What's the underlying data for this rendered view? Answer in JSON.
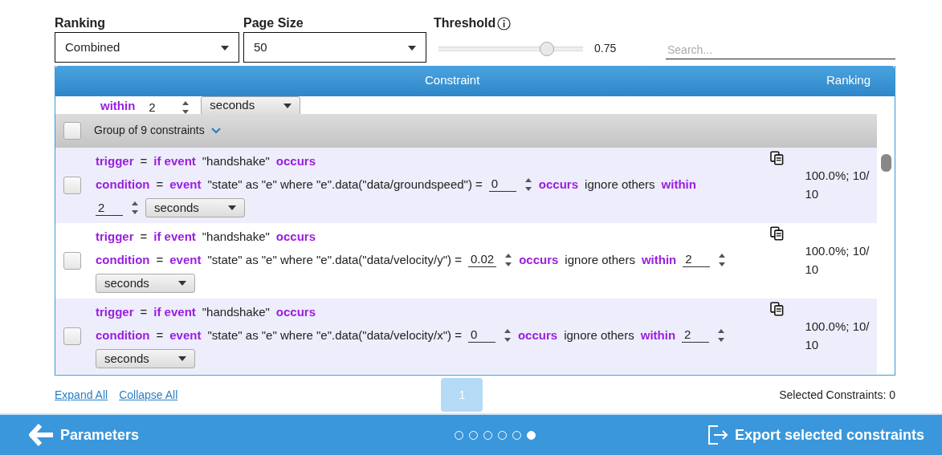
{
  "filters": {
    "ranking": {
      "label": "Ranking",
      "value": "Combined"
    },
    "page_size": {
      "label": "Page Size",
      "value": "50"
    },
    "threshold": {
      "label": "Threshold",
      "level": 0.75,
      "reading": "0.75"
    },
    "search": {
      "placeholder": "Search..."
    }
  },
  "table": {
    "columns": [
      "Constraint",
      "Ranking"
    ],
    "partial_row": [
      {
        "kind": "kw",
        "text": "within"
      },
      {
        "kind": "num",
        "value": "2"
      },
      {
        "kind": "select",
        "value": "seconds"
      }
    ],
    "group": {
      "label": "Group of 9 constraints",
      "checked": false,
      "expanded": true
    },
    "rows": [
      {
        "checked": false,
        "shaded": true,
        "ranking": "100.0%; 10/10",
        "lines": [
          [
            {
              "kind": "kw",
              "text": "trigger"
            },
            {
              "kind": "text",
              "text": "="
            },
            {
              "kind": "kw",
              "text": "if event"
            },
            {
              "kind": "text",
              "text": "\"handshake\""
            },
            {
              "kind": "kw",
              "text": "occurs"
            }
          ],
          [
            {
              "kind": "kw",
              "text": "condition"
            },
            {
              "kind": "text",
              "text": "="
            },
            {
              "kind": "kw",
              "text": "event"
            },
            {
              "kind": "text",
              "text": "\"state\" as \"e\" where \"e\".data(\"data/groundspeed\") ="
            },
            {
              "kind": "num",
              "value": "0"
            },
            {
              "kind": "kw",
              "text": "occurs"
            },
            {
              "kind": "text",
              "text": "ignore others"
            },
            {
              "kind": "kw",
              "text": "within"
            }
          ],
          [
            {
              "kind": "num",
              "value": "2"
            },
            {
              "kind": "select",
              "value": "seconds"
            }
          ]
        ]
      },
      {
        "checked": false,
        "shaded": false,
        "ranking": "100.0%; 10/10",
        "lines": [
          [
            {
              "kind": "kw",
              "text": "trigger"
            },
            {
              "kind": "text",
              "text": "="
            },
            {
              "kind": "kw",
              "text": "if event"
            },
            {
              "kind": "text",
              "text": "\"handshake\""
            },
            {
              "kind": "kw",
              "text": "occurs"
            }
          ],
          [
            {
              "kind": "kw",
              "text": "condition"
            },
            {
              "kind": "text",
              "text": "="
            },
            {
              "kind": "kw",
              "text": "event"
            },
            {
              "kind": "text",
              "text": "\"state\" as \"e\" where \"e\".data(\"data/velocity/y\") ="
            },
            {
              "kind": "num",
              "value": "0.02"
            },
            {
              "kind": "kw",
              "text": "occurs"
            },
            {
              "kind": "text",
              "text": "ignore others"
            },
            {
              "kind": "kw",
              "text": "within"
            },
            {
              "kind": "num",
              "value": "2"
            }
          ],
          [
            {
              "kind": "select",
              "value": "seconds"
            }
          ]
        ]
      },
      {
        "checked": false,
        "shaded": true,
        "ranking": "100.0%; 10/10",
        "lines": [
          [
            {
              "kind": "kw",
              "text": "trigger"
            },
            {
              "kind": "text",
              "text": "="
            },
            {
              "kind": "kw",
              "text": "if event"
            },
            {
              "kind": "text",
              "text": "\"handshake\""
            },
            {
              "kind": "kw",
              "text": "occurs"
            }
          ],
          [
            {
              "kind": "kw",
              "text": "condition"
            },
            {
              "kind": "text",
              "text": "="
            },
            {
              "kind": "kw",
              "text": "event"
            },
            {
              "kind": "text",
              "text": "\"state\" as \"e\" where \"e\".data(\"data/velocity/x\") ="
            },
            {
              "kind": "num",
              "value": "0"
            },
            {
              "kind": "kw",
              "text": "occurs"
            },
            {
              "kind": "text",
              "text": "ignore others"
            },
            {
              "kind": "kw",
              "text": "within"
            },
            {
              "kind": "num",
              "value": "2"
            }
          ],
          [
            {
              "kind": "select",
              "value": "seconds"
            }
          ]
        ]
      }
    ]
  },
  "footer": {
    "links": [
      "Expand All",
      "Collapse All"
    ],
    "pages": [
      {
        "label": "1",
        "selected": true
      }
    ],
    "selected_count": "Selected Constraints: 0"
  },
  "bottom_bar": {
    "back": "Parameters",
    "steps": [
      {
        "selected": false
      },
      {
        "selected": false
      },
      {
        "selected": false
      },
      {
        "selected": false
      },
      {
        "selected": false
      },
      {
        "selected": true
      }
    ],
    "export": "Export selected constraints"
  }
}
